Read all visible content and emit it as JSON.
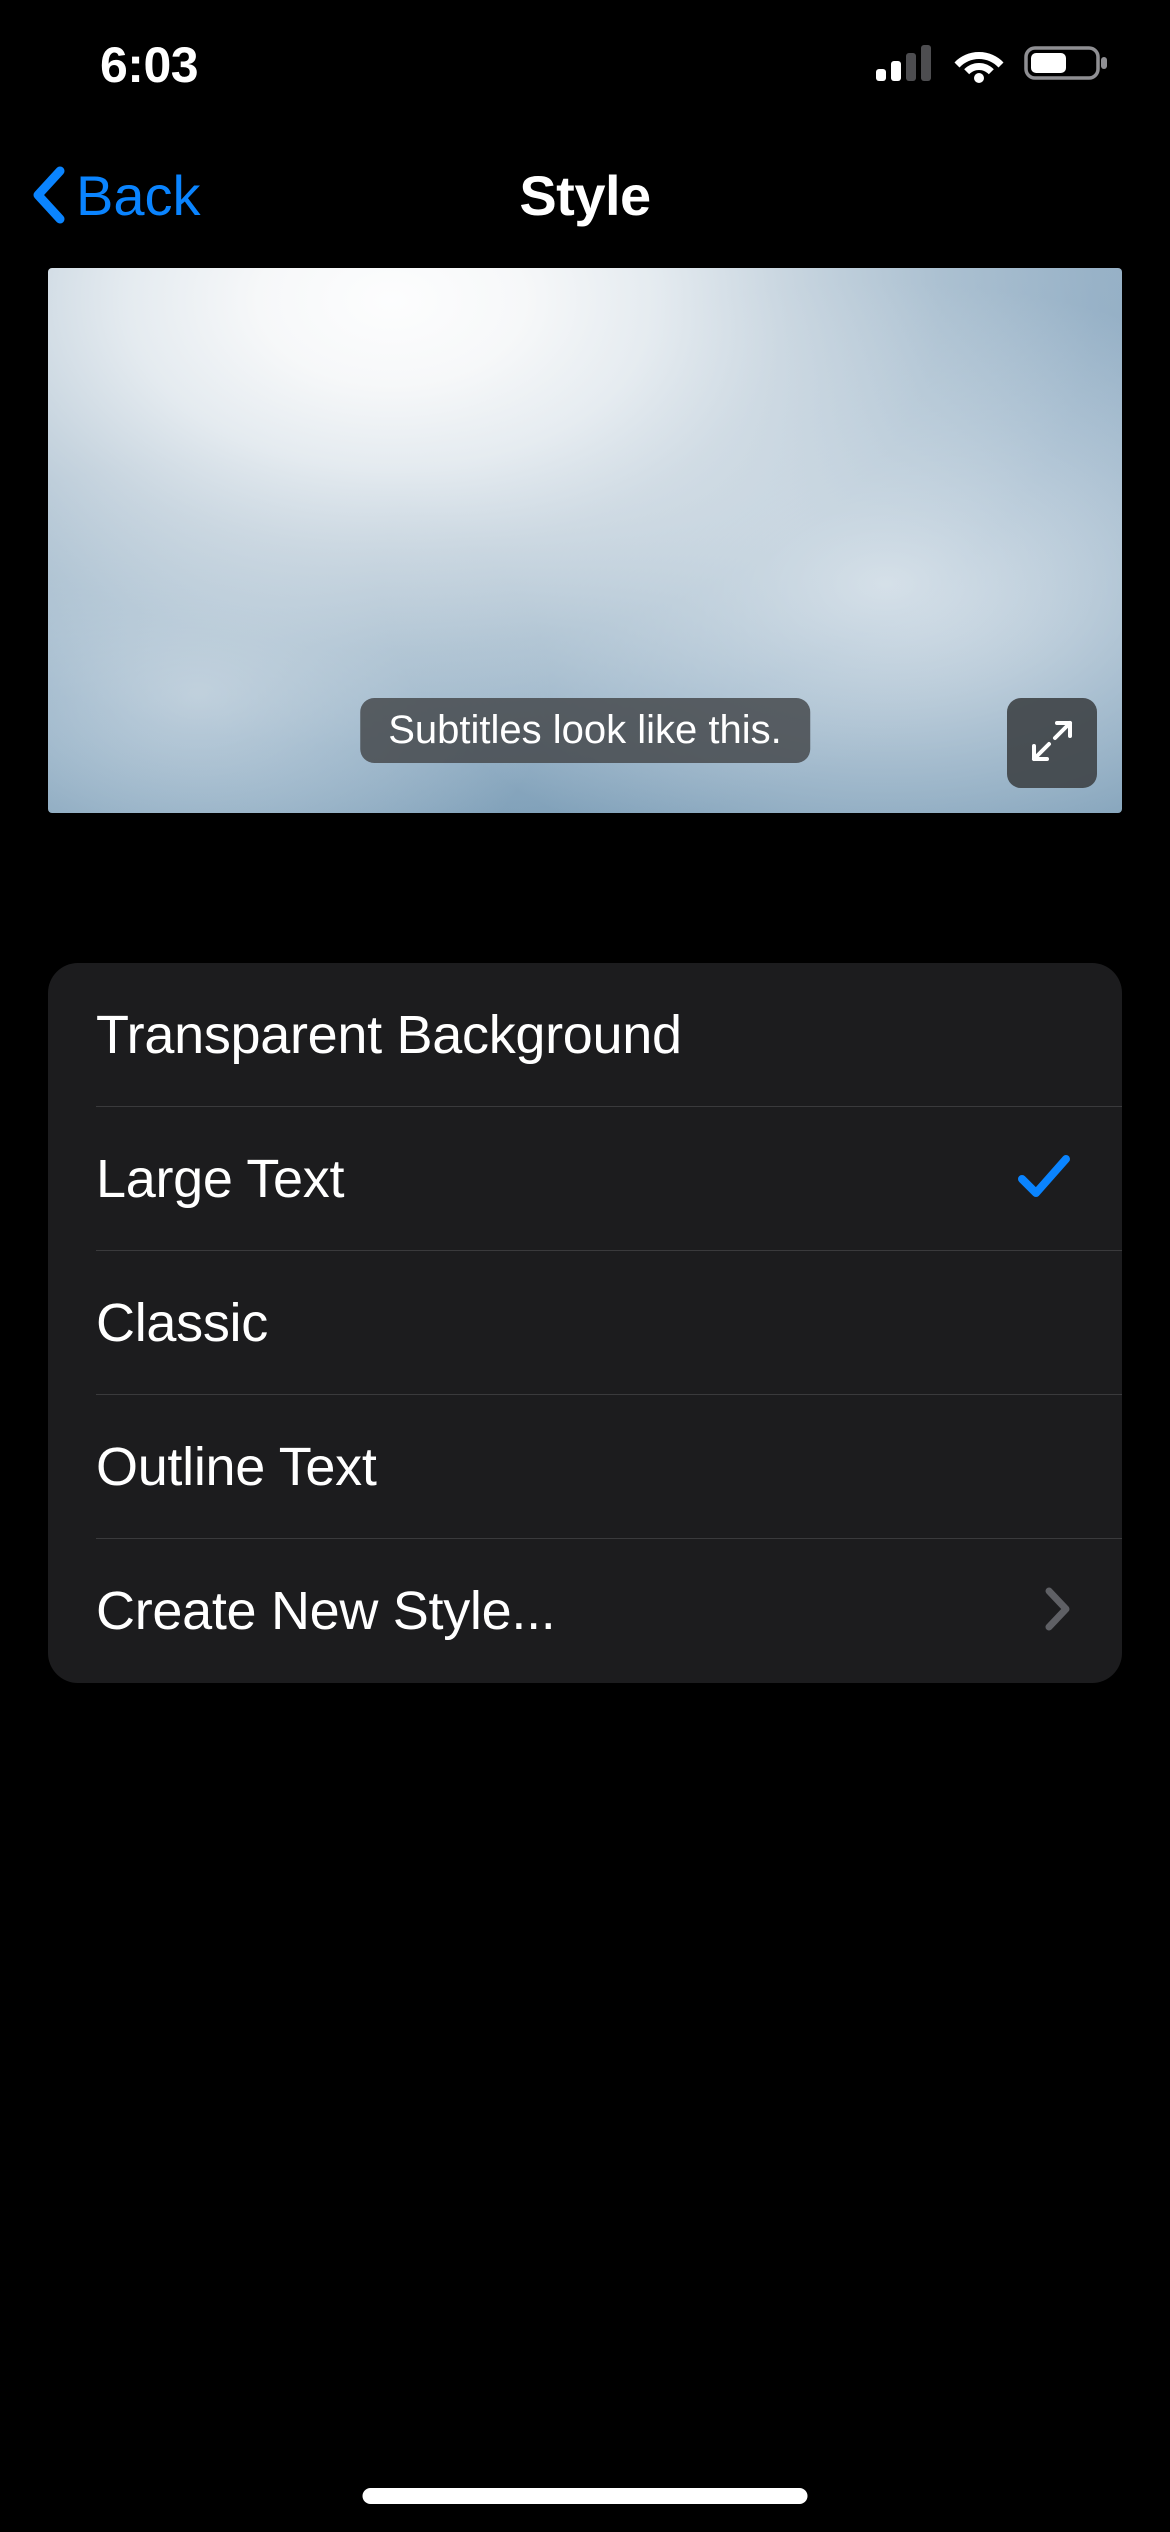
{
  "status_bar": {
    "time": "6:03",
    "cellular_bars": 2,
    "wifi": true,
    "battery_pct": 55
  },
  "nav": {
    "back_label": "Back",
    "title": "Style"
  },
  "preview": {
    "subtitle_sample": "Subtitles look like this."
  },
  "styles": {
    "items": [
      {
        "label": "Transparent Background",
        "selected": false
      },
      {
        "label": "Large Text",
        "selected": true
      },
      {
        "label": "Classic",
        "selected": false
      },
      {
        "label": "Outline Text",
        "selected": false
      }
    ],
    "create_label": "Create New Style..."
  },
  "colors": {
    "accent": "#0a84ff",
    "list_bg": "#1c1c1e"
  }
}
